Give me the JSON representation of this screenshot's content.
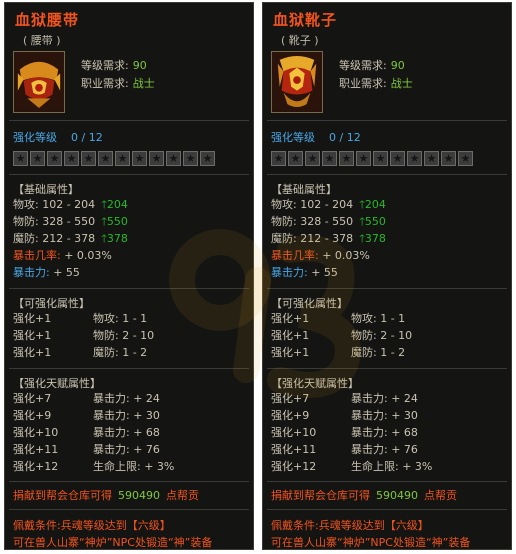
{
  "items": [
    {
      "name": "血狱腰带",
      "type": "( 腰带 )",
      "level_label": "等级需求:",
      "level_value": "90",
      "class_label": "职业需求:",
      "class_value": "战士",
      "enhance_label": "强化等级",
      "enhance_value": "0 / 12",
      "star_count": 12,
      "base_head": "【基础属性】",
      "base": [
        {
          "label": "物攻:",
          "value": "102 - 204",
          "bonus": "204"
        },
        {
          "label": "物防:",
          "value": "328 - 550",
          "bonus": "550"
        },
        {
          "label": "魔防:",
          "value": "212 - 378",
          "bonus": "378"
        },
        {
          "label": "暴击几率:",
          "value": "+ 0.03%",
          "bonus": ""
        },
        {
          "label": "暴击力:",
          "value": "+ 55",
          "bonus": ""
        }
      ],
      "enhanceable_head": "【可强化属性】",
      "enhanceable": [
        {
          "lv": "强化+1",
          "attr": "物攻: 1 - 1"
        },
        {
          "lv": "强化+1",
          "attr": "物防: 2 - 10"
        },
        {
          "lv": "强化+1",
          "attr": "魔防: 1 - 2"
        }
      ],
      "talent_head": "【强化天赋属性】",
      "talent": [
        {
          "lv": "强化+7",
          "attr": "暴击力: + 24"
        },
        {
          "lv": "强化+9",
          "attr": "暴击力: + 30"
        },
        {
          "lv": "强化+10",
          "attr": "暴击力: + 68"
        },
        {
          "lv": "强化+11",
          "attr": "暴击力: + 76"
        },
        {
          "lv": "强化+12",
          "attr": "生命上限: + 3%"
        }
      ],
      "donate_prefix": "捐献到帮会仓库可得",
      "donate_amount": "590490",
      "donate_suffix": "点帮贡",
      "cond1": "佩戴条件:兵魂等级达到【六级】",
      "cond2": "可在兽人山寨“神炉”NPC处锻造“神”装备"
    },
    {
      "name": "血狱靴子",
      "type": "( 靴子 )",
      "level_label": "等级需求:",
      "level_value": "90",
      "class_label": "职业需求:",
      "class_value": "战士",
      "enhance_label": "强化等级",
      "enhance_value": "0 / 12",
      "star_count": 12,
      "base_head": "【基础属性】",
      "base": [
        {
          "label": "物攻:",
          "value": "102 - 204",
          "bonus": "204"
        },
        {
          "label": "物防:",
          "value": "328 - 550",
          "bonus": "550"
        },
        {
          "label": "魔防:",
          "value": "212 - 378",
          "bonus": "378"
        },
        {
          "label": "暴击几率:",
          "value": "+ 0.03%",
          "bonus": ""
        },
        {
          "label": "暴击力:",
          "value": "+ 55",
          "bonus": ""
        }
      ],
      "enhanceable_head": "【可强化属性】",
      "enhanceable": [
        {
          "lv": "强化+1",
          "attr": "物攻: 1 - 1"
        },
        {
          "lv": "强化+1",
          "attr": "物防: 2 - 10"
        },
        {
          "lv": "强化+1",
          "attr": "魔防: 1 - 2"
        }
      ],
      "talent_head": "【强化天赋属性】",
      "talent": [
        {
          "lv": "强化+7",
          "attr": "暴击力: + 24"
        },
        {
          "lv": "强化+9",
          "attr": "暴击力: + 30"
        },
        {
          "lv": "强化+10",
          "attr": "暴击力: + 68"
        },
        {
          "lv": "强化+11",
          "attr": "暴击力: + 76"
        },
        {
          "lv": "强化+12",
          "attr": "生命上限: + 3%"
        }
      ],
      "donate_prefix": "捐献到帮会仓库可得",
      "donate_amount": "590490",
      "donate_suffix": "点帮贡",
      "cond1": "佩戴条件:兵魂等级达到【六级】",
      "cond2": "可在兽人山寨“神炉”NPC处锻造“神”装备"
    }
  ],
  "icons": [
    "belt-item-icon",
    "boots-item-icon",
    "star-icon",
    "up-arrow-icon"
  ],
  "colors": {
    "title": "#f2541d",
    "level": "#7ec83d",
    "enhance": "#4aa7e4",
    "bonus": "#27b82b"
  }
}
